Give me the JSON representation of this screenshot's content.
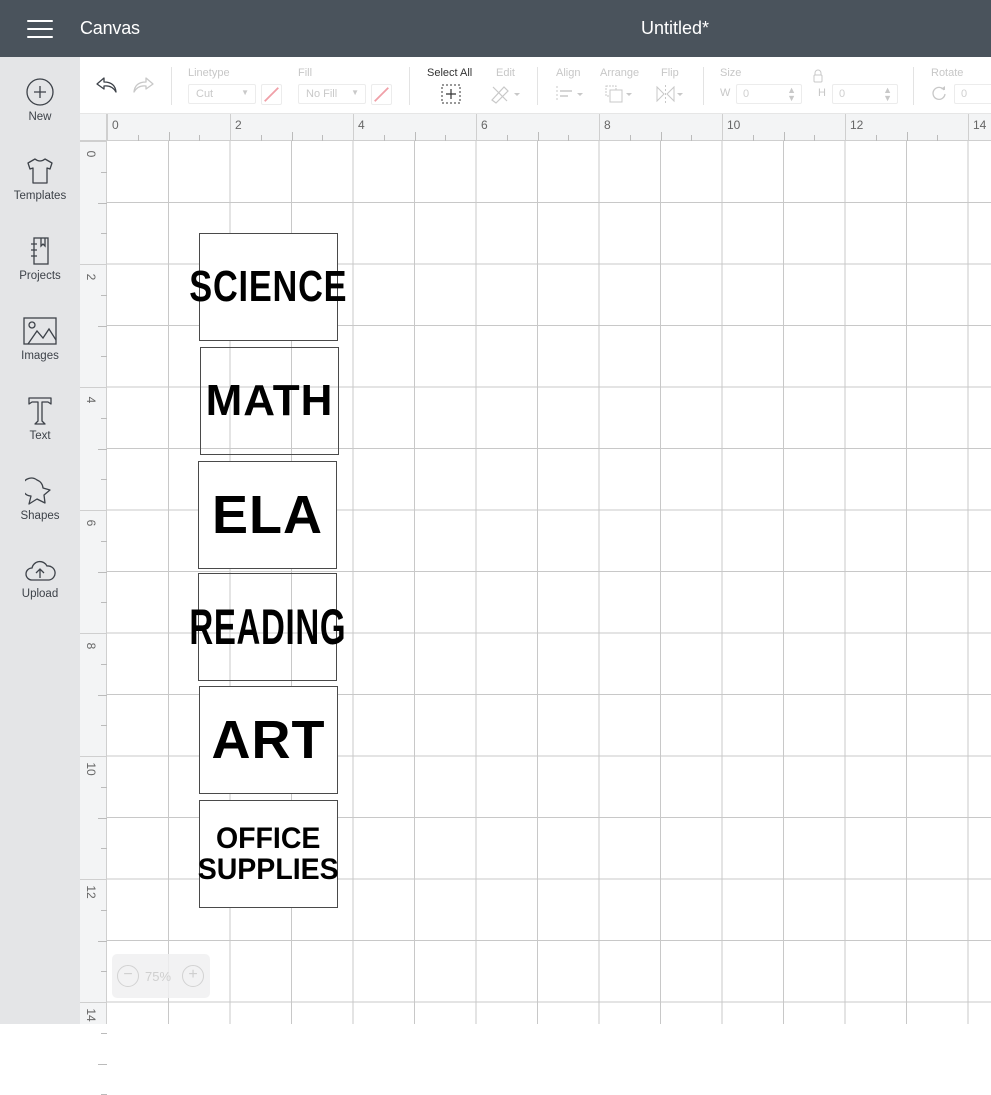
{
  "header": {
    "app_title": "Canvas",
    "document_title": "Untitled*"
  },
  "sidebar": {
    "items": [
      {
        "label": "New",
        "icon": "plus-circle-icon"
      },
      {
        "label": "Templates",
        "icon": "tshirt-icon"
      },
      {
        "label": "Projects",
        "icon": "notebook-icon"
      },
      {
        "label": "Images",
        "icon": "image-icon"
      },
      {
        "label": "Text",
        "icon": "text-t-icon"
      },
      {
        "label": "Shapes",
        "icon": "shapes-icon"
      },
      {
        "label": "Upload",
        "icon": "cloud-upload-icon"
      }
    ]
  },
  "toolbar": {
    "linetype_label": "Linetype",
    "linetype_value": "Cut",
    "fill_label": "Fill",
    "fill_value": "No Fill",
    "select_all_label": "Select All",
    "edit_label": "Edit",
    "align_label": "Align",
    "arrange_label": "Arrange",
    "flip_label": "Flip",
    "size_label": "Size",
    "width_label": "W",
    "width_value": "0",
    "height_label": "H",
    "height_value": "0",
    "rotate_label": "Rotate",
    "rotate_value": "0"
  },
  "rulers": {
    "x_labels": [
      "0",
      "2",
      "4",
      "6",
      "8",
      "10",
      "12",
      "14"
    ],
    "y_labels": [
      "0",
      "2",
      "4",
      "6",
      "8",
      "10",
      "12",
      "14"
    ]
  },
  "canvas": {
    "cards": [
      {
        "lines": [
          "SCIENCE"
        ],
        "opaque": true
      },
      {
        "lines": [
          "MATH"
        ],
        "opaque": false
      },
      {
        "lines": [
          "ELA"
        ],
        "opaque": true
      },
      {
        "lines": [
          "READING"
        ],
        "opaque": false
      },
      {
        "lines": [
          "ART"
        ],
        "opaque": true
      },
      {
        "lines": [
          "OFFICE",
          "SUPPLIES"
        ],
        "opaque": true
      }
    ]
  },
  "zoom": {
    "value": "75%",
    "minus": "−",
    "plus": "+"
  },
  "colors": {
    "header_bg": "#4a535c",
    "sidebar_bg": "#e4e5e7",
    "grid_line": "#c8c8c8",
    "no_fill_slash": "#f0a0a8"
  }
}
